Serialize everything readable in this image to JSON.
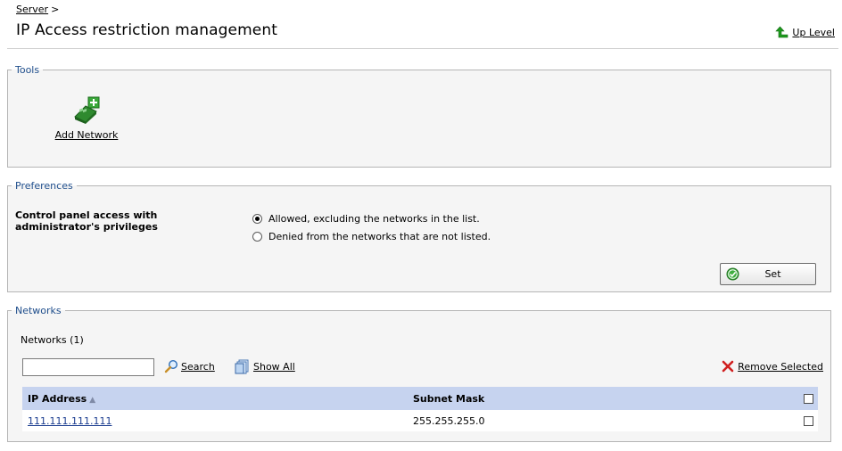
{
  "breadcrumb": {
    "link": "Server",
    "separator": ">"
  },
  "page": {
    "title": "IP Access restriction management",
    "up_level": "Up Level"
  },
  "tools": {
    "legend": "Tools",
    "items": [
      {
        "label": "Add Network",
        "icon": "add-network-icon"
      }
    ]
  },
  "preferences": {
    "legend": "Preferences",
    "label": "Control panel access with administrator's privileges",
    "options": [
      {
        "label": "Allowed, excluding the networks in the list.",
        "selected": true
      },
      {
        "label": "Denied from the networks that are not listed.",
        "selected": false
      }
    ],
    "set_button": "Set"
  },
  "networks": {
    "legend": "Networks",
    "count_label": "Networks (1)",
    "search": {
      "value": "",
      "link": "Search"
    },
    "show_all": "Show All",
    "remove_selected": "Remove Selected",
    "columns": {
      "ip": "IP Address",
      "mask": "Subnet Mask"
    },
    "rows": [
      {
        "ip": "111.111.111.111",
        "mask": "255.255.255.0",
        "checked": false
      }
    ]
  },
  "colors": {
    "header_bg": "#c6d3ef",
    "legend": "#1f4e8c",
    "link": "#1a3c8f"
  }
}
